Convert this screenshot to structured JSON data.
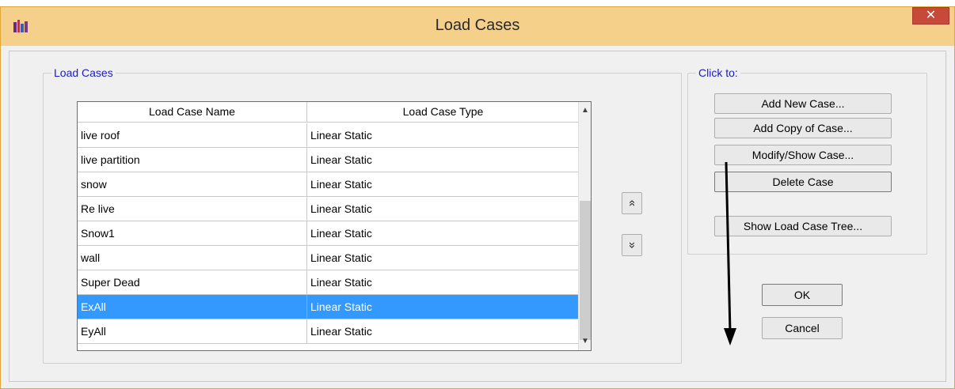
{
  "window": {
    "title": "Load Cases",
    "close_icon": "close-icon",
    "close_glyph": "✕",
    "app_icon": "etabs-app-icon"
  },
  "load_cases_group": {
    "legend": "Load Cases",
    "columns": [
      "Load Case Name",
      "Load Case Type"
    ],
    "rows": [
      {
        "name": "live roof",
        "type": "Linear Static"
      },
      {
        "name": "live partition",
        "type": "Linear Static"
      },
      {
        "name": "snow",
        "type": "Linear Static"
      },
      {
        "name": "Re live",
        "type": "Linear Static"
      },
      {
        "name": "Snow1",
        "type": "Linear Static"
      },
      {
        "name": "wall",
        "type": "Linear Static"
      },
      {
        "name": "Super Dead",
        "type": "Linear Static"
      },
      {
        "name": "ExAll",
        "type": "Linear Static",
        "selected": true
      },
      {
        "name": "EyAll",
        "type": "Linear Static"
      }
    ],
    "selected_row": "ExAll",
    "move_up_icon": "double-chevron-up-icon",
    "move_down_icon": "double-chevron-down-icon",
    "move_up_glyph": "»",
    "move_down_glyph": "»"
  },
  "click_to_group": {
    "legend": "Click to:",
    "add_new": "Add New Case...",
    "add_copy": "Add Copy of Case...",
    "modify_show": "Modify/Show Case...",
    "delete": "Delete Case",
    "show_tree": "Show Load Case Tree..."
  },
  "dialog_buttons": {
    "ok": "OK",
    "cancel": "Cancel"
  },
  "annotation": {
    "icon": "down-arrow-annotation-icon"
  },
  "colors": {
    "titlebar": "#f5d08a",
    "selection": "#3399ff",
    "legend_text": "#1a1acb",
    "close_button": "#c7493a"
  }
}
